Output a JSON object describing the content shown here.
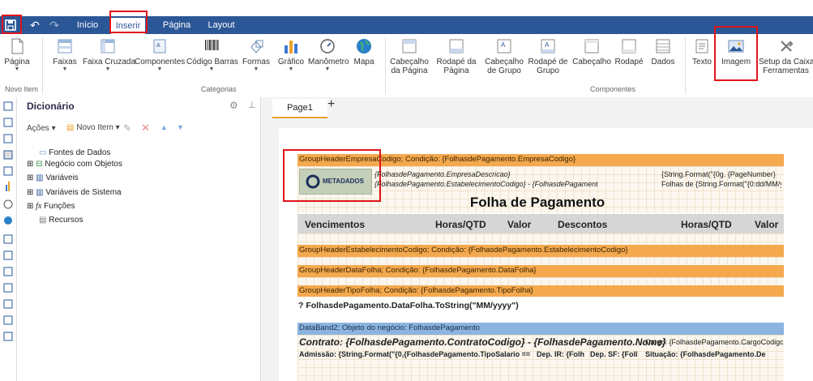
{
  "tabs": [
    {
      "label": "Início"
    },
    {
      "label": "Inserir"
    },
    {
      "label": "Página"
    },
    {
      "label": "Layout"
    }
  ],
  "ribbon": {
    "buttons": [
      {
        "label": "Página",
        "sub": ""
      },
      {
        "label": "Faixas",
        "sub": ""
      },
      {
        "label": "Faixa Cruzada",
        "sub": ""
      },
      {
        "label": "Componentes",
        "sub": ""
      },
      {
        "label": "Código Barras",
        "sub": ""
      },
      {
        "label": "Formas",
        "sub": ""
      },
      {
        "label": "Gráfico",
        "sub": ""
      },
      {
        "label": "Manômetro",
        "sub": ""
      },
      {
        "label": "Mapa",
        "sub": ""
      },
      {
        "label": "Cabeçalho",
        "sub": "da Página"
      },
      {
        "label": "Rodapé da",
        "sub": "Página"
      },
      {
        "label": "Cabeçalho",
        "sub": "de Grupo"
      },
      {
        "label": "Rodapé de",
        "sub": "Grupo"
      },
      {
        "label": "Cabeçalho",
        "sub": ""
      },
      {
        "label": "Rodapé",
        "sub": ""
      },
      {
        "label": "Dados",
        "sub": ""
      },
      {
        "label": "Texto",
        "sub": ""
      },
      {
        "label": "Imagem",
        "sub": ""
      },
      {
        "label": "Setup da Caixa",
        "sub": "Ferramentas"
      }
    ],
    "groups": {
      "new_item": "Novo Item",
      "categories": "Categorias",
      "components": "Componentes"
    }
  },
  "dictionary": {
    "title": "Dicionário",
    "actions": "Ações",
    "new_item": "Novo Item",
    "tree": [
      {
        "label": "Fontes de Dados"
      },
      {
        "label": "Negócio com Objetos"
      },
      {
        "label": "Variáveis"
      },
      {
        "label": "Variáveis de Sistema"
      },
      {
        "label": "Funções"
      },
      {
        "label": "Recursos"
      }
    ]
  },
  "page_tab": {
    "label": "Page1",
    "add": "+"
  },
  "report": {
    "band1": "GroupHeaderEmpresaCodigo; Condição: {FolhasdePagamento.EmpresaCodigo}",
    "logo_text": "METADADOS",
    "field_desc": "{FolhasdePagamento.EmpresaDescricao}",
    "field_estab": "{FolhasdePagamento.EstabelecimentoCodigo} - {FolhasdePagamento.E",
    "field_page": "{String.Format(\"{0g. {PageNumber}",
    "field_folhas": "Folhas de {String.Format(\"{0:dd/MM/y",
    "title": "Folha de Pagamento",
    "headers": [
      "Vencimentos",
      "Horas/QTD",
      "Valor",
      "Descontos",
      "Horas/QTD",
      "Valor"
    ],
    "band2": "GroupHeaderEstabelecimentoCodigo; Condição: {FolhasdePagamento.EstabelecimentoCodigo}",
    "band3": "GroupHeaderDataFolha; Condição: {FolhasdePagamento.DataFolha}",
    "band4": "GroupHeaderTipoFolha; Condição: {FolhasdePagamento.TipoFolha}",
    "overlap_line": "? FolhasdePagamento.DataFolha.ToString(\"MM/yyyy\")",
    "band5": "DataBand2; Objeto do negócio: FolhasdePagamento",
    "contrato": "Contrato:  {FolhasdePagamento.ContratoCodigo} - {FolhasdePagamento.Nome}",
    "cargo": "Cargo: {FolhasdePagamento.CargoCodigo}",
    "admissao": "Admissão: {String.Format(\"{0,{FolhasdePagamento.TipoSalario ==",
    "dep_ir": "Dep. IR: {Folh",
    "dep_sf": "Dep. SF: {Foll",
    "situacao": "Situação: {FolhasdePagamento.De"
  },
  "colors": {
    "ribbon_blue": "#2b5797",
    "highlight_red": "#e0151a",
    "band_orange": "#f4a94e",
    "band_blue": "#8cb4e0"
  }
}
